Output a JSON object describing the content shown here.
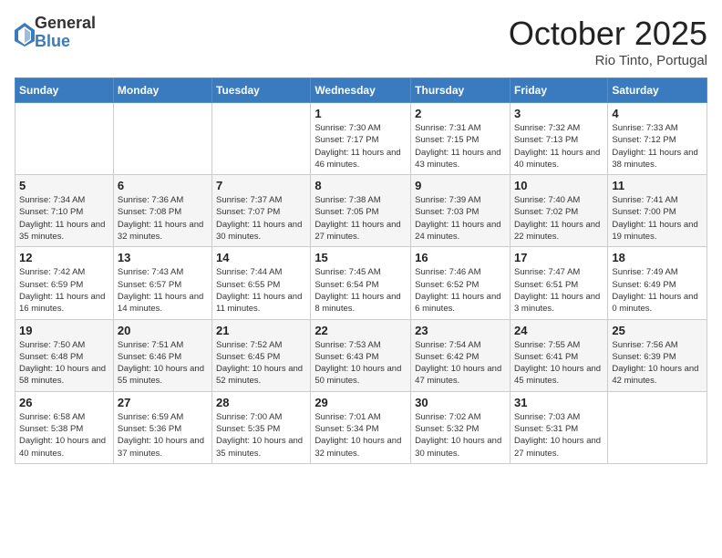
{
  "header": {
    "logo": {
      "general": "General",
      "blue": "Blue"
    },
    "title": "October 2025",
    "subtitle": "Rio Tinto, Portugal"
  },
  "days_of_week": [
    "Sunday",
    "Monday",
    "Tuesday",
    "Wednesday",
    "Thursday",
    "Friday",
    "Saturday"
  ],
  "weeks": [
    [
      {
        "day": "",
        "info": ""
      },
      {
        "day": "",
        "info": ""
      },
      {
        "day": "",
        "info": ""
      },
      {
        "day": "1",
        "info": "Sunrise: 7:30 AM\nSunset: 7:17 PM\nDaylight: 11 hours and 46 minutes."
      },
      {
        "day": "2",
        "info": "Sunrise: 7:31 AM\nSunset: 7:15 PM\nDaylight: 11 hours and 43 minutes."
      },
      {
        "day": "3",
        "info": "Sunrise: 7:32 AM\nSunset: 7:13 PM\nDaylight: 11 hours and 40 minutes."
      },
      {
        "day": "4",
        "info": "Sunrise: 7:33 AM\nSunset: 7:12 PM\nDaylight: 11 hours and 38 minutes."
      }
    ],
    [
      {
        "day": "5",
        "info": "Sunrise: 7:34 AM\nSunset: 7:10 PM\nDaylight: 11 hours and 35 minutes."
      },
      {
        "day": "6",
        "info": "Sunrise: 7:36 AM\nSunset: 7:08 PM\nDaylight: 11 hours and 32 minutes."
      },
      {
        "day": "7",
        "info": "Sunrise: 7:37 AM\nSunset: 7:07 PM\nDaylight: 11 hours and 30 minutes."
      },
      {
        "day": "8",
        "info": "Sunrise: 7:38 AM\nSunset: 7:05 PM\nDaylight: 11 hours and 27 minutes."
      },
      {
        "day": "9",
        "info": "Sunrise: 7:39 AM\nSunset: 7:03 PM\nDaylight: 11 hours and 24 minutes."
      },
      {
        "day": "10",
        "info": "Sunrise: 7:40 AM\nSunset: 7:02 PM\nDaylight: 11 hours and 22 minutes."
      },
      {
        "day": "11",
        "info": "Sunrise: 7:41 AM\nSunset: 7:00 PM\nDaylight: 11 hours and 19 minutes."
      }
    ],
    [
      {
        "day": "12",
        "info": "Sunrise: 7:42 AM\nSunset: 6:59 PM\nDaylight: 11 hours and 16 minutes."
      },
      {
        "day": "13",
        "info": "Sunrise: 7:43 AM\nSunset: 6:57 PM\nDaylight: 11 hours and 14 minutes."
      },
      {
        "day": "14",
        "info": "Sunrise: 7:44 AM\nSunset: 6:55 PM\nDaylight: 11 hours and 11 minutes."
      },
      {
        "day": "15",
        "info": "Sunrise: 7:45 AM\nSunset: 6:54 PM\nDaylight: 11 hours and 8 minutes."
      },
      {
        "day": "16",
        "info": "Sunrise: 7:46 AM\nSunset: 6:52 PM\nDaylight: 11 hours and 6 minutes."
      },
      {
        "day": "17",
        "info": "Sunrise: 7:47 AM\nSunset: 6:51 PM\nDaylight: 11 hours and 3 minutes."
      },
      {
        "day": "18",
        "info": "Sunrise: 7:49 AM\nSunset: 6:49 PM\nDaylight: 11 hours and 0 minutes."
      }
    ],
    [
      {
        "day": "19",
        "info": "Sunrise: 7:50 AM\nSunset: 6:48 PM\nDaylight: 10 hours and 58 minutes."
      },
      {
        "day": "20",
        "info": "Sunrise: 7:51 AM\nSunset: 6:46 PM\nDaylight: 10 hours and 55 minutes."
      },
      {
        "day": "21",
        "info": "Sunrise: 7:52 AM\nSunset: 6:45 PM\nDaylight: 10 hours and 52 minutes."
      },
      {
        "day": "22",
        "info": "Sunrise: 7:53 AM\nSunset: 6:43 PM\nDaylight: 10 hours and 50 minutes."
      },
      {
        "day": "23",
        "info": "Sunrise: 7:54 AM\nSunset: 6:42 PM\nDaylight: 10 hours and 47 minutes."
      },
      {
        "day": "24",
        "info": "Sunrise: 7:55 AM\nSunset: 6:41 PM\nDaylight: 10 hours and 45 minutes."
      },
      {
        "day": "25",
        "info": "Sunrise: 7:56 AM\nSunset: 6:39 PM\nDaylight: 10 hours and 42 minutes."
      }
    ],
    [
      {
        "day": "26",
        "info": "Sunrise: 6:58 AM\nSunset: 5:38 PM\nDaylight: 10 hours and 40 minutes."
      },
      {
        "day": "27",
        "info": "Sunrise: 6:59 AM\nSunset: 5:36 PM\nDaylight: 10 hours and 37 minutes."
      },
      {
        "day": "28",
        "info": "Sunrise: 7:00 AM\nSunset: 5:35 PM\nDaylight: 10 hours and 35 minutes."
      },
      {
        "day": "29",
        "info": "Sunrise: 7:01 AM\nSunset: 5:34 PM\nDaylight: 10 hours and 32 minutes."
      },
      {
        "day": "30",
        "info": "Sunrise: 7:02 AM\nSunset: 5:32 PM\nDaylight: 10 hours and 30 minutes."
      },
      {
        "day": "31",
        "info": "Sunrise: 7:03 AM\nSunset: 5:31 PM\nDaylight: 10 hours and 27 minutes."
      },
      {
        "day": "",
        "info": ""
      }
    ]
  ]
}
